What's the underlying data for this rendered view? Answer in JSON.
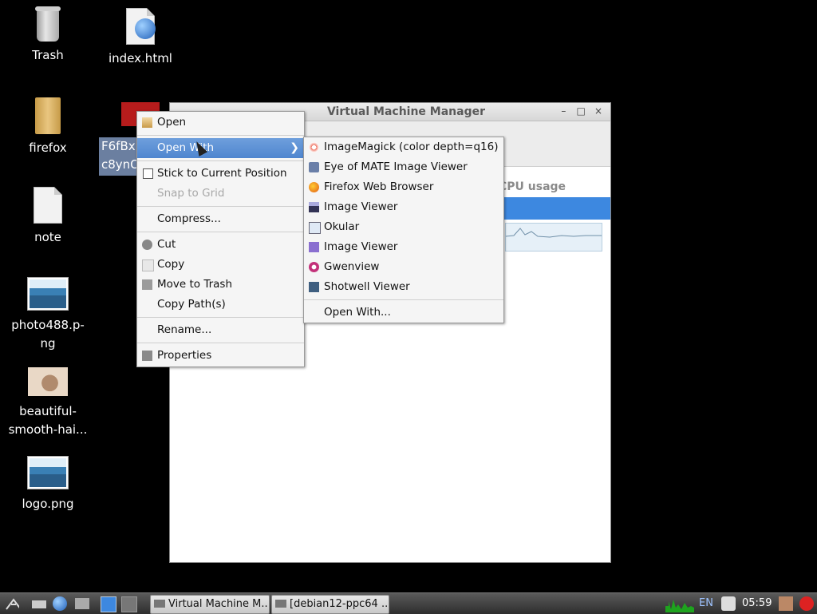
{
  "desktop": {
    "icons": [
      {
        "label": "Trash",
        "icon": "trash-icon"
      },
      {
        "label": "index.html",
        "icon": "web-file-icon"
      },
      {
        "label": "firefox",
        "icon": "folder-icon"
      },
      {
        "label": "note",
        "icon": "text-file-icon"
      },
      {
        "label": "photo488.p-ng",
        "label_line1": "photo488.p-",
        "label_line2": "ng",
        "icon": "image-icon"
      },
      {
        "label": "beautiful-smooth-hai...",
        "label_line1": "beautiful-",
        "label_line2": "smooth-hai...",
        "icon": "cat-photo-icon"
      },
      {
        "label": "logo.png",
        "icon": "image-icon"
      }
    ],
    "selected_file_line1": "F6fBx",
    "selected_file_line2": "c8ynO"
  },
  "window": {
    "title": "Virtual Machine Manager",
    "column_header": "CPU usage",
    "buttons": {
      "minimize": "–",
      "maximize": "□",
      "close": "×"
    }
  },
  "context_menu": {
    "items": [
      {
        "label": "Open",
        "icon": "open-icon"
      },
      {
        "label": "Open With",
        "highlighted": true,
        "has_submenu": true
      },
      {
        "label": "Stick to Current Position",
        "checkbox": true
      },
      {
        "label": "Snap to Grid",
        "disabled": true
      },
      {
        "label": "Compress..."
      },
      {
        "label": "Cut",
        "icon": "cut-icon"
      },
      {
        "label": "Copy",
        "icon": "copy-icon"
      },
      {
        "label": "Move to Trash",
        "icon": "trash-icon"
      },
      {
        "label": "Copy Path(s)"
      },
      {
        "label": "Rename..."
      },
      {
        "label": "Properties",
        "icon": "properties-icon"
      }
    ]
  },
  "open_with_submenu": {
    "items": [
      {
        "label": "ImageMagick (color depth=q16)",
        "icon": "imagemagick-icon"
      },
      {
        "label": "Eye of MATE Image Viewer",
        "icon": "eye-of-mate-icon"
      },
      {
        "label": "Firefox Web Browser",
        "icon": "firefox-icon"
      },
      {
        "label": "Image Viewer",
        "icon": "image-viewer-icon"
      },
      {
        "label": "Okular",
        "icon": "okular-icon"
      },
      {
        "label": "Image Viewer",
        "icon": "image-viewer-alt-icon"
      },
      {
        "label": "Gwenview",
        "icon": "gwenview-icon"
      },
      {
        "label": "Shotwell Viewer",
        "icon": "shotwell-icon"
      },
      {
        "label": "Open With..."
      }
    ]
  },
  "taskbar": {
    "tasks": [
      {
        "label": "Virtual Machine M..."
      },
      {
        "label": "[debian12-ppc64 ..."
      }
    ],
    "keyboard_layout": "EN",
    "clock": "05:59"
  }
}
